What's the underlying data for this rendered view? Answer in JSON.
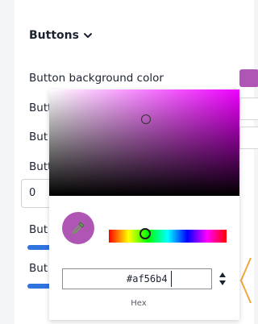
{
  "section": {
    "title": "Buttons"
  },
  "rows": {
    "bg_color_label": "Button background color",
    "truncated_label": "Butt",
    "truncated_label_short": "But",
    "number_value": "0"
  },
  "color_picker": {
    "current_color": "#af56b4",
    "hex_value": "#af56b4",
    "format_label": "Hex"
  },
  "colors": {
    "accent_slider": "#2f73df",
    "swatch": "#af56b4"
  }
}
